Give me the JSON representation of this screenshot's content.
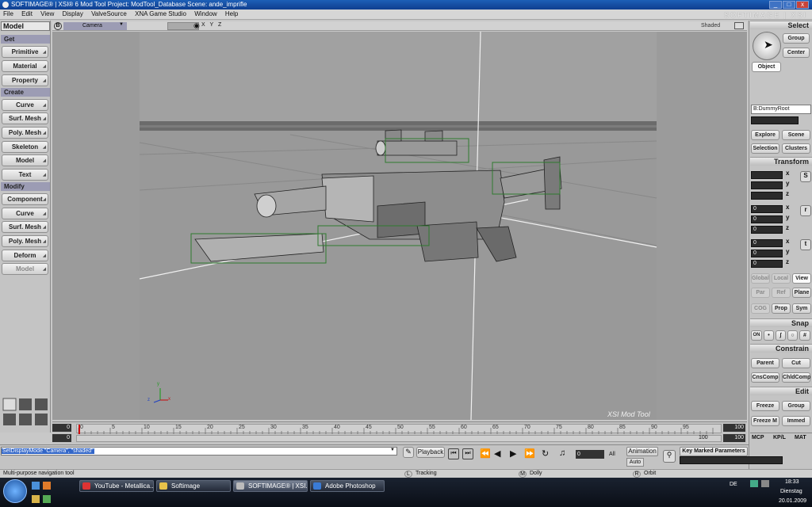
{
  "window": {
    "title": "SOFTIMAGE® | XSI® 6 Mod Tool Project: ModTool_Database    Scene: ande_imprifle",
    "brand": "SOFTIMAGE | XSI",
    "minimize": "_",
    "maximize": "□",
    "close": "x"
  },
  "menu": [
    "File",
    "Edit",
    "View",
    "Display",
    "ValveSource",
    "XNA Game Studio",
    "Window",
    "Help"
  ],
  "left_panel": {
    "mode": "Model",
    "sections": [
      {
        "header": "Get",
        "buttons": [
          "Primitive",
          "Material",
          "Property"
        ]
      },
      {
        "header": "Create",
        "buttons": [
          "Curve",
          "Surf. Mesh",
          "Poly. Mesh",
          "Skeleton",
          "Model",
          "Text"
        ]
      },
      {
        "header": "Modify",
        "buttons": [
          "Component",
          "Curve",
          "Surf. Mesh",
          "Poly. Mesh",
          "Deform",
          "Model"
        ]
      }
    ]
  },
  "viewport": {
    "letter": "B",
    "camera": "Camera",
    "axes_label": "X Y Z",
    "shading": "Shaded",
    "watermark": "XSI Mod Tool"
  },
  "timeline": {
    "start": "0",
    "start2": "0",
    "end": "100",
    "end2": "100",
    "ticks": [
      "0",
      "5",
      "10",
      "15",
      "20",
      "25",
      "30",
      "35",
      "40",
      "45",
      "50",
      "55",
      "60",
      "65",
      "70",
      "75",
      "80",
      "85",
      "90",
      "95"
    ],
    "end_tick": "100"
  },
  "command": {
    "line": "SetDisplayMode \"Camera\", \"shaded\"",
    "playback": "Playback",
    "frame": "0",
    "all": "All",
    "animation": "Animation",
    "auto": "Auto",
    "key_marked": "Key Marked Parameters"
  },
  "status": {
    "hint": "Multi-purpose navigation tool",
    "L": "L",
    "L_action": "Tracking",
    "M": "M",
    "M_action": "Dolly",
    "R": "R",
    "R_action": "Orbit"
  },
  "right_panel": {
    "select_header": "Select",
    "group": "Group",
    "center": "Center",
    "object": "Object",
    "name_field": "B:DummyRoot",
    "explore": "Explore",
    "scene": "Scene",
    "selection": "Selection",
    "clusters": "Clusters",
    "transform_header": "Transform",
    "axes": [
      "x",
      "y",
      "z"
    ],
    "scale_icon": "S",
    "rotate_icon": "r",
    "translate_icon": "t",
    "rot_values": [
      "0",
      "0",
      "0"
    ],
    "trans_values": [
      "0",
      "0",
      "0"
    ],
    "global": "Global",
    "local": "Local",
    "view": "View",
    "par": "Par",
    "ref": "Ref",
    "plane": "Plane",
    "cog": "COG",
    "prop": "Prop",
    "sym": "Sym",
    "snap_header": "Snap",
    "on": "ON",
    "constrain_header": "Constrain",
    "parent": "Parent",
    "cut": "Cut",
    "cnscomp": "CnsComp",
    "chldcomp": "ChldComp",
    "edit_header": "Edit",
    "freeze": "Freeze",
    "group2": "Group",
    "freeze_m": "Freeze M",
    "immed": "Immed",
    "tabs": [
      "MCP",
      "KP/L",
      "MAT"
    ]
  },
  "taskbar": {
    "items": [
      {
        "label": "YouTube - Metallica...",
        "color": "#d33"
      },
      {
        "label": "Softimage",
        "color": "#e8c24a"
      },
      {
        "label": "SOFTIMAGE® | XSI...",
        "color": "#bbb"
      },
      {
        "label": "Adobe Photoshop",
        "color": "#3a7bd5"
      }
    ],
    "lang": "DE",
    "time": "18:33",
    "day": "Dienstag",
    "date": "20.01.2009"
  }
}
